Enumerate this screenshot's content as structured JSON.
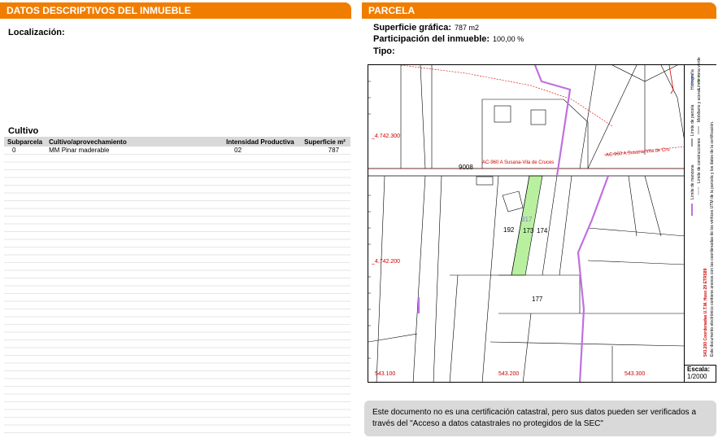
{
  "left": {
    "header": "DATOS DESCRIPTIVOS DEL INMUEBLE",
    "localizacion_label": "Localización:",
    "cultivo_label": "Cultivo",
    "table": {
      "headers": [
        "Subparcela",
        "Cultivo/aprovechamiento",
        "Intensidad Productiva",
        "Superficie m²"
      ],
      "rows": [
        [
          "0",
          "MM Pinar maderable",
          "02",
          "787"
        ]
      ]
    }
  },
  "right": {
    "header": "PARCELA",
    "superficie_label": "Superficie gráfica:",
    "superficie_value": "787 m2",
    "participacion_label": "Participación del inmueble:",
    "participacion_value": "100,00 %",
    "tipo_label": "Tipo:"
  },
  "map": {
    "coords": {
      "y1": "_4.742.300",
      "y2": "_4.742.200",
      "x1": "543.100",
      "x2": "543.200",
      "x3": "543.300"
    },
    "road_label_1": "AC-960 A Susana-Vila de Cruces",
    "road_label_2": "AC-960 A Susana-Vila de Cru",
    "parcel_numbers": [
      "9008",
      "192",
      "173",
      "174",
      "177"
    ],
    "highlight_label": "317",
    "legend_lines": [
      "Límite de manzana",
      "Límite de parcela",
      "Hidrografía"
    ],
    "legend_lines_2": [
      "Límite de construcciones",
      "Mobiliario y aceras",
      "Límite zona verde"
    ],
    "legend_red": "543.200 Coordenadas U.T.M. Huso 29 ETRS89",
    "legend_note": "Este documento electrónico contiene anexos con las coordenadas de los vértices UTM de la parcela y los datos de la certificación.",
    "scale_label": "Escala:",
    "scale_value": "1/2000",
    "colors": {
      "parcel_fill": "#b8f0a0",
      "boundary": "#c070e0",
      "road_red": "#d00000"
    }
  },
  "footer": "Este documento no es una certificación catastral, pero sus datos pueden ser verificados a través del \"Acceso a datos catastrales no protegidos de la SEC\""
}
